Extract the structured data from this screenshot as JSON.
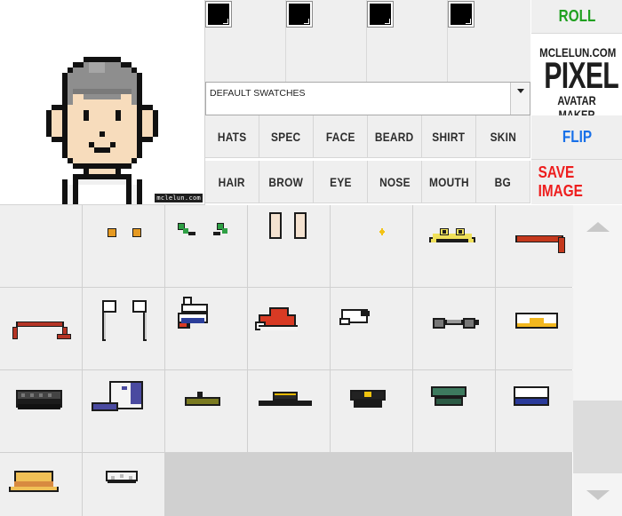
{
  "app": {
    "logo_line1": "MCLELUN.COM",
    "logo_line2": "PIXEL",
    "logo_line3": "AVATAR MAKER",
    "preview_credit": "mclelun.com"
  },
  "actions": {
    "roll": "ROLL",
    "flip": "FLIP",
    "save": "SAVE IMAGE",
    "roll_color": "#20a020",
    "flip_color": "#1870e8",
    "save_color": "#ee1d1d"
  },
  "swatches": [
    {
      "name": "color-swatch-1",
      "color": "#000000"
    },
    {
      "name": "color-swatch-2",
      "color": "#000000"
    },
    {
      "name": "color-swatch-3",
      "color": "#000000"
    },
    {
      "name": "color-swatch-4",
      "color": "#000000"
    }
  ],
  "palette": {
    "selected": "DEFAULT SWATCHES"
  },
  "categories_row1": [
    "HATS",
    "SPEC",
    "FACE",
    "BEARD",
    "SHIRT",
    "SKIN"
  ],
  "categories_row2": [
    "HAIR",
    "BROW",
    "EYE",
    "NOSE",
    "MOUTH",
    "BG"
  ],
  "items": [
    {
      "name": "item-none",
      "icon": "none"
    },
    {
      "name": "item-orange-ear-studs-icon",
      "icon": "ear-studs",
      "color": "#e69a22"
    },
    {
      "name": "item-green-ear-clips-icon",
      "icon": "ear-clips",
      "color": "#2fa045"
    },
    {
      "name": "item-bunny-ears-icon",
      "icon": "bunny-ears",
      "color": "#f4e2d0"
    },
    {
      "name": "item-sparkle-icon",
      "icon": "sparkle",
      "color": "#f3c316"
    },
    {
      "name": "item-frog-headband-icon",
      "icon": "frog-headband",
      "color": "#efe05a"
    },
    {
      "name": "item-red-headband-icon",
      "icon": "red-headband",
      "color": "#c5391d"
    },
    {
      "name": "item-ribbon-headband-icon",
      "icon": "ribbon-headband",
      "color": "#b53526"
    },
    {
      "name": "item-maid-headband-icon",
      "icon": "maid-headband",
      "color": "#ffffff"
    },
    {
      "name": "item-sailor-cap-icon",
      "icon": "sailor-cap",
      "color": "#ffffff"
    },
    {
      "name": "item-santa-hat-icon",
      "icon": "santa-hat",
      "color": "#d83a24"
    },
    {
      "name": "item-white-beanie-icon",
      "icon": "white-beanie",
      "color": "#ffffff"
    },
    {
      "name": "item-goggles-icon",
      "icon": "goggles",
      "color": "#555555"
    },
    {
      "name": "item-egg-cap-icon",
      "icon": "egg-cap",
      "color": "#f2b71e"
    },
    {
      "name": "item-black-newsboy-cap-icon",
      "icon": "newsboy-cap",
      "color": "#333333"
    },
    {
      "name": "item-baseball-cap-icon",
      "icon": "baseball-cap",
      "color": "#4a4aa0"
    },
    {
      "name": "item-beret-icon",
      "icon": "beret",
      "color": "#7a7a20"
    },
    {
      "name": "item-bowler-hat-icon",
      "icon": "bowler-hat",
      "color": "#2a2a2a"
    },
    {
      "name": "item-police-cap-icon",
      "icon": "police-cap",
      "color": "#1d1d1d"
    },
    {
      "name": "item-green-military-cap-icon",
      "icon": "military-cap",
      "color": "#3d7a5e"
    },
    {
      "name": "item-navy-cap-icon",
      "icon": "navy-cap",
      "color": "#2a3a9a"
    },
    {
      "name": "item-straw-hat-icon",
      "icon": "straw-hat",
      "color": "#f0c056"
    },
    {
      "name": "item-paper-hat-icon",
      "icon": "paper-hat",
      "color": "#f4f4f4"
    }
  ]
}
